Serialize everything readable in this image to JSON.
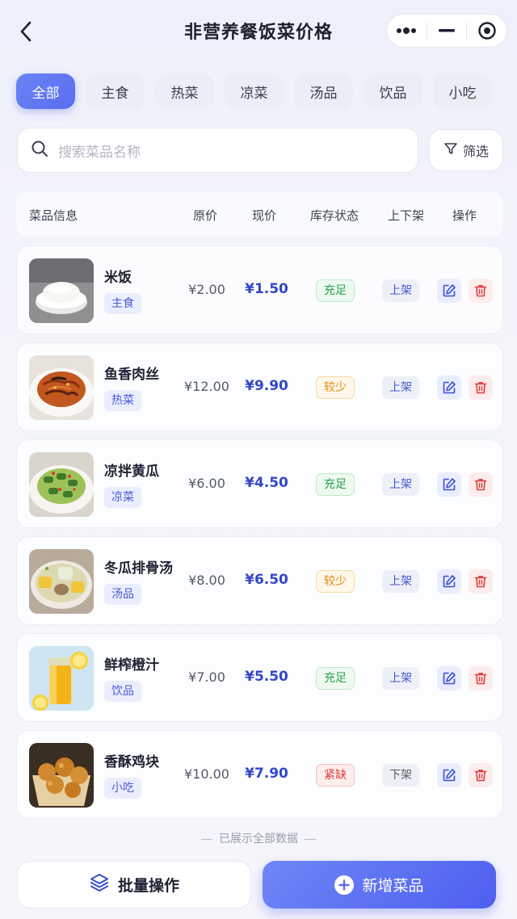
{
  "header": {
    "title": "非营养餐饭菜价格"
  },
  "tabs": [
    "全部",
    "主食",
    "热菜",
    "凉菜",
    "汤品",
    "饮品",
    "小吃"
  ],
  "active_tab": "全部",
  "search": {
    "placeholder": "搜索菜品名称",
    "filter_label": "筛选"
  },
  "table": {
    "headers": {
      "info": "菜品信息",
      "orig": "原价",
      "now": "现价",
      "stock": "库存状态",
      "shelf": "上下架",
      "ops": "操作"
    }
  },
  "dishes": [
    {
      "name": "米饭",
      "category": "主食",
      "orig": "¥2.00",
      "now": "¥1.50",
      "stock": "充足",
      "stock_color": "#27a24a",
      "shelf": "上架"
    },
    {
      "name": "鱼香肉丝",
      "category": "热菜",
      "orig": "¥12.00",
      "now": "¥9.90",
      "stock": "较少",
      "stock_color": "#e08a0b",
      "shelf": "上架"
    },
    {
      "name": "凉拌黄瓜",
      "category": "凉菜",
      "orig": "¥6.00",
      "now": "¥4.50",
      "stock": "充足",
      "stock_color": "#27a24a",
      "shelf": "上架"
    },
    {
      "name": "冬瓜排骨汤",
      "category": "汤品",
      "orig": "¥8.00",
      "now": "¥6.50",
      "stock": "较少",
      "stock_color": "#e08a0b",
      "shelf": "上架"
    },
    {
      "name": "鲜榨橙汁",
      "category": "饮品",
      "orig": "¥7.00",
      "now": "¥5.50",
      "stock": "充足",
      "stock_color": "#27a24a",
      "shelf": "上架"
    },
    {
      "name": "香酥鸡块",
      "category": "小吃",
      "orig": "¥10.00",
      "now": "¥7.90",
      "stock": "紧缺",
      "stock_color": "#e23b3b",
      "shelf": "下架"
    }
  ],
  "footer": {
    "end_tip": "已展示全部数据",
    "bulk_label": "批量操作",
    "add_label": "新增菜品"
  },
  "colors": {
    "accent": "#5b6cf0",
    "price": "#3346c9"
  }
}
